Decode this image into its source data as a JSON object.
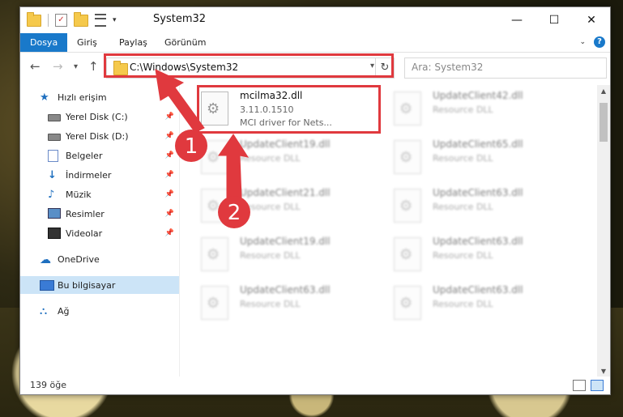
{
  "window": {
    "title": "System32",
    "minimize": "—",
    "maximize": "☐",
    "close": "✕"
  },
  "ribbon": {
    "tabs": [
      "Dosya",
      "Giriş",
      "Paylaş",
      "Görünüm"
    ]
  },
  "nav": {
    "address": "C:\\Windows\\System32",
    "search_placeholder": "Ara: System32"
  },
  "sidebar": {
    "items": [
      {
        "label": "Hızlı erişim"
      },
      {
        "label": "Yerel Disk (C:)"
      },
      {
        "label": "Yerel Disk (D:)"
      },
      {
        "label": "Belgeler"
      },
      {
        "label": "İndirmeler"
      },
      {
        "label": "Müzik"
      },
      {
        "label": "Resimler"
      },
      {
        "label": "Videolar"
      },
      {
        "label": "OneDrive"
      },
      {
        "label": "Bu bilgisayar"
      },
      {
        "label": "Ağ"
      }
    ]
  },
  "files": [
    {
      "name": "mcilma32.dll",
      "line1": "3.11.0.1510",
      "line2": "MCI driver for Nets..."
    },
    {
      "name": "UpdateClient42.dll",
      "line1": "Resource DLL"
    },
    {
      "name": "UpdateClient19.dll",
      "line1": "Resource DLL"
    },
    {
      "name": "UpdateClient65.dll",
      "line1": "Resource DLL"
    },
    {
      "name": "UpdateClient21.dll",
      "line1": "Resource DLL"
    },
    {
      "name": "UpdateClient63.dll",
      "line1": "Resource DLL"
    },
    {
      "name": "UpdateClient19.dll",
      "line1": "Resource DLL"
    },
    {
      "name": "UpdateClient63.dll",
      "line1": "Resource DLL"
    },
    {
      "name": "UpdateClient63.dll",
      "line1": "Resource DLL"
    },
    {
      "name": "UpdateClient63.dll",
      "line1": "Resource DLL"
    }
  ],
  "status": {
    "count": "139 öğe"
  },
  "annotations": {
    "badge1": "1",
    "badge2": "2",
    "color": "#e0393e"
  }
}
